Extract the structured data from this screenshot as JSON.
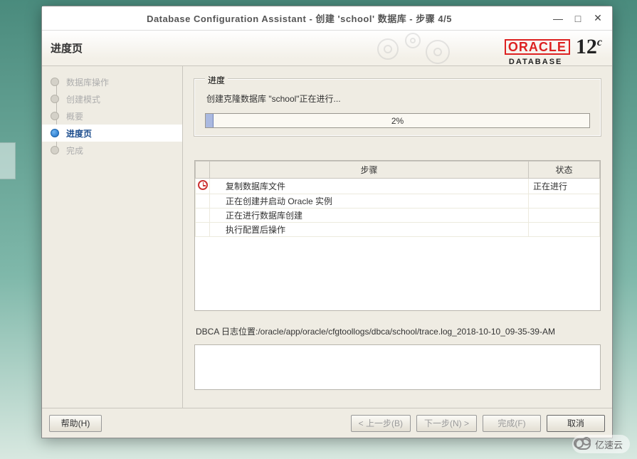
{
  "window": {
    "title": "Database Configuration Assistant - 创建  'school' 数据库  -  步骤 4/5",
    "minimize_glyph": "—",
    "maximize_glyph": "□",
    "close_glyph": "✕"
  },
  "header": {
    "page_title": "进度页",
    "brand": "ORACLE",
    "product_sub": "DATABASE",
    "version": "12",
    "version_suffix": "c"
  },
  "sidebar": {
    "items": [
      {
        "label": "数据库操作",
        "active": false
      },
      {
        "label": "创建模式",
        "active": false
      },
      {
        "label": "概要",
        "active": false
      },
      {
        "label": "进度页",
        "active": true
      },
      {
        "label": "完成",
        "active": false
      }
    ]
  },
  "progress": {
    "group_label": "进度",
    "message": "创建克隆数据库 \"school\"正在进行...",
    "percent_value": 2,
    "percent_text": "2%"
  },
  "table": {
    "headers": {
      "step": "步骤",
      "status": "状态"
    },
    "rows": [
      {
        "icon": "clock",
        "step": "复制数据库文件",
        "status": "正在进行"
      },
      {
        "icon": "",
        "step": "正在创建并启动 Oracle 实例",
        "status": ""
      },
      {
        "icon": "",
        "step": "正在进行数据库创建",
        "status": ""
      },
      {
        "icon": "",
        "step": "执行配置后操作",
        "status": ""
      }
    ]
  },
  "log": {
    "label": "DBCA 日志位置:/oracle/app/oracle/cfgtoollogs/dbca/school/trace.log_2018-10-10_09-35-39-AM"
  },
  "footer": {
    "help": "帮助(H)",
    "back": "< 上一步(B)",
    "next": "下一步(N) >",
    "finish": "完成(F)",
    "cancel": "取消"
  },
  "watermark": {
    "text": "亿速云"
  }
}
